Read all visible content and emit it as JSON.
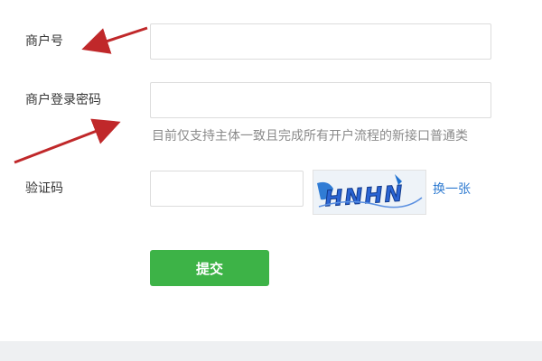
{
  "form": {
    "merchant_id": {
      "label": "商户号",
      "value": "",
      "placeholder": ""
    },
    "password": {
      "label": "商户登录密码",
      "value": "",
      "placeholder": "",
      "hint": "目前仅支持主体一致且完成所有开户流程的新接口普通类"
    },
    "captcha": {
      "label": "验证码",
      "value": "",
      "placeholder": "",
      "image_text": "HNHN",
      "refresh_label": "换一张"
    },
    "submit_label": "提交"
  },
  "colors": {
    "submit": "#3db347",
    "link": "#2f7bd1",
    "arrow": "#c0282a",
    "hint": "#8a8a8a"
  },
  "icons": [
    "arrow-annotation-icon",
    "captcha-image"
  ]
}
